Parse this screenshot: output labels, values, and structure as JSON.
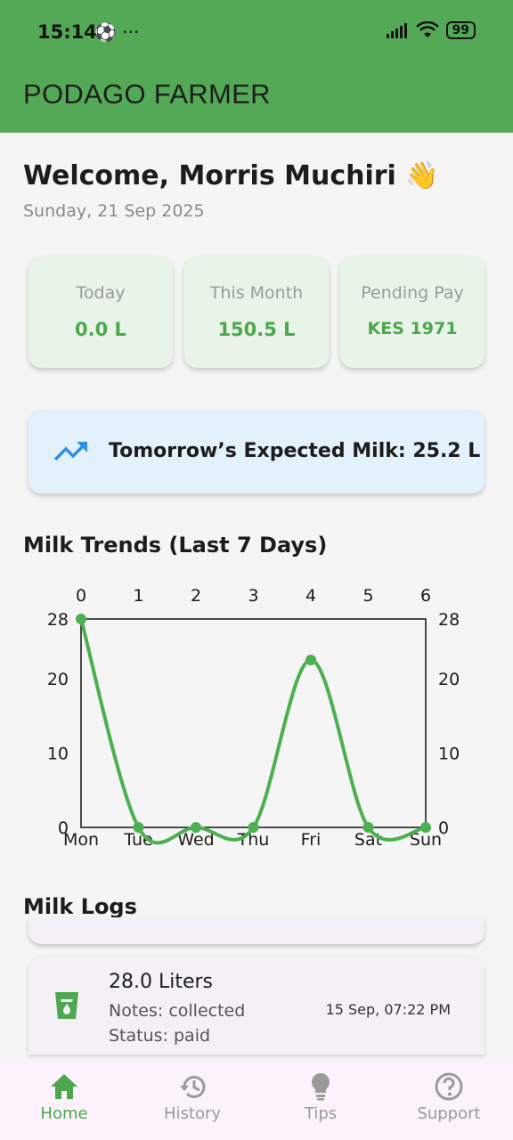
{
  "status_bar": {
    "time": "15:14",
    "left_icons": "⚽ ···",
    "battery": "99"
  },
  "app_bar": {
    "title": "PODAGO FARMER"
  },
  "greeting": {
    "welcome": "Welcome, Morris Muchiri 👋",
    "date": "Sunday, 21 Sep 2025"
  },
  "stats": [
    {
      "label": "Today",
      "value": "0.0 L"
    },
    {
      "label": "This Month",
      "value": "150.5 L"
    },
    {
      "label": "Pending Pay",
      "value": "KES 1971"
    }
  ],
  "forecast": {
    "text": "Tomorrow’s Expected Milk: 25.2 L",
    "icon": "trending-up-icon"
  },
  "trends": {
    "title": "Milk Trends (Last 7 Days)"
  },
  "chart_data": {
    "type": "line",
    "x": [
      0,
      1,
      2,
      3,
      4,
      5,
      6
    ],
    "categories": [
      "Mon",
      "Tue",
      "Wed",
      "Thu",
      "Fri",
      "Sat",
      "Sun"
    ],
    "top_ticks": [
      "0",
      "1",
      "2",
      "3",
      "4",
      "5",
      "6"
    ],
    "y_ticks": [
      "0",
      "10",
      "20",
      "28"
    ],
    "values": [
      28,
      0,
      0,
      0,
      22.5,
      0,
      0
    ],
    "ylim": [
      0,
      28
    ],
    "color": "#4caf50",
    "title": "",
    "xlabel": "",
    "ylabel": ""
  },
  "logs": {
    "title": "Milk Logs",
    "items": [
      {
        "liters": "28.0 Liters",
        "notes": "Notes: collected",
        "status": "Status: paid",
        "time": "15 Sep, 07:22 PM"
      }
    ]
  },
  "nav": [
    {
      "label": "Home",
      "icon": "home-icon"
    },
    {
      "label": "History",
      "icon": "history-icon"
    },
    {
      "label": "Tips",
      "icon": "lightbulb-icon"
    },
    {
      "label": "Support",
      "icon": "help-icon"
    }
  ],
  "colors": {
    "primary": "#53a955",
    "accent": "#4ca74e",
    "stat_bg": "#e8f4e7",
    "forecast_bg": "#e3f1fb"
  }
}
